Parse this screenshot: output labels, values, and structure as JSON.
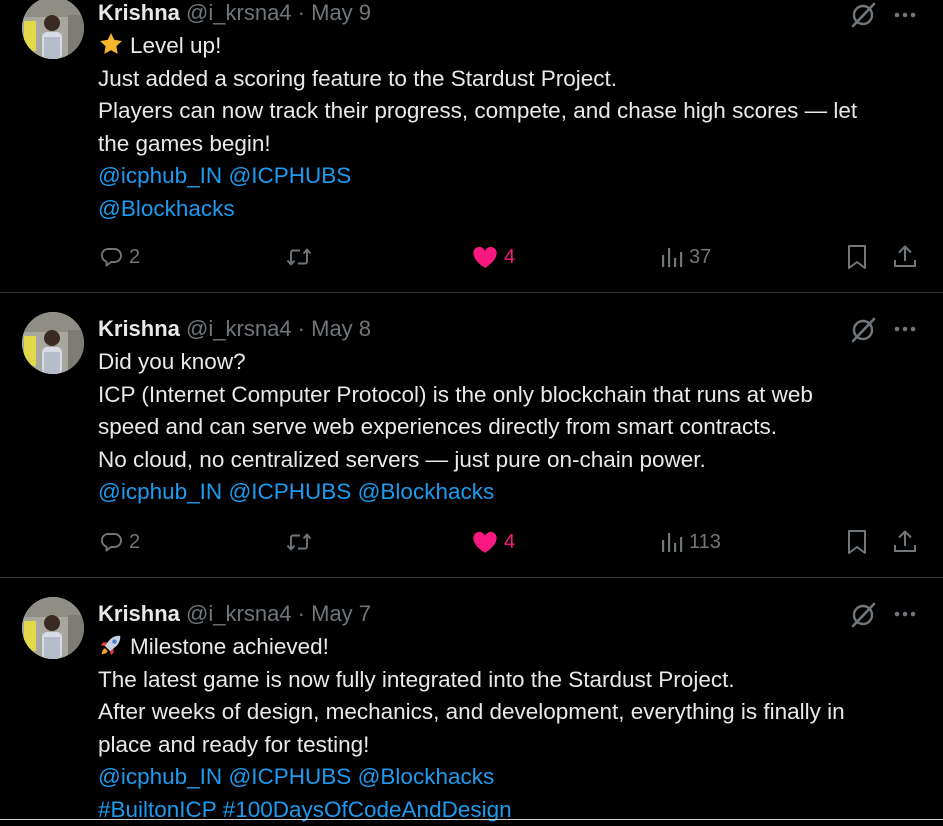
{
  "tweets": [
    {
      "author_name": "Krishna",
      "handle": "@i_krsna4",
      "separator": "·",
      "date": "May 9",
      "lines": [
        {
          "emoji": "star",
          "text": "Level up!"
        },
        {
          "text": "Just added a scoring feature to the Stardust Project."
        },
        {
          "text": "Players can now track their progress, compete, and chase high scores — let"
        },
        {
          "text": "the games begin!"
        },
        {
          "mentions": [
            "@icphub_IN",
            "@ICPHUBS"
          ]
        },
        {
          "mentions": [
            "@Blockhacks"
          ]
        }
      ],
      "replies": "2",
      "likes": "4",
      "views": "37",
      "liked": true
    },
    {
      "author_name": "Krishna",
      "handle": "@i_krsna4",
      "separator": "·",
      "date": "May 8",
      "lines": [
        {
          "text": "Did you know?"
        },
        {
          "text": "ICP (Internet Computer Protocol) is the only blockchain that runs at web"
        },
        {
          "text": "speed and can serve web experiences directly from smart contracts."
        },
        {
          "text": "No cloud, no centralized servers — just pure on-chain power."
        },
        {
          "mentions": [
            "@icphub_IN",
            "@ICPHUBS",
            "@Blockhacks"
          ]
        }
      ],
      "replies": "2",
      "likes": "4",
      "views": "113",
      "liked": true
    },
    {
      "author_name": "Krishna",
      "handle": "@i_krsna4",
      "separator": "·",
      "date": "May 7",
      "lines": [
        {
          "emoji": "rocket",
          "text": "Milestone achieved!"
        },
        {
          "text": "The latest game is now fully integrated into the Stardust Project."
        },
        {
          "text": "After weeks of design, mechanics, and development, everything is finally in"
        },
        {
          "text": "place and ready for testing!"
        },
        {
          "mentions": [
            "@icphub_IN",
            "@ICPHUBS",
            "@Blockhacks"
          ]
        },
        {
          "mentions": [
            "#BuiltonICP",
            "#100DaysOfCodeAndDesign"
          ]
        }
      ]
    }
  ],
  "icons": {
    "grok": "grok-icon",
    "more": "more-options-icon",
    "reply": "reply-icon",
    "retweet": "retweet-icon",
    "like": "heart-icon",
    "views": "views-icon",
    "bookmark": "bookmark-icon",
    "share": "share-icon"
  },
  "colors": {
    "background": "#000000",
    "text": "#e7e9ea",
    "muted": "#71767b",
    "link": "#1d9bf0",
    "like": "#f91880",
    "divider": "#2f3336"
  }
}
